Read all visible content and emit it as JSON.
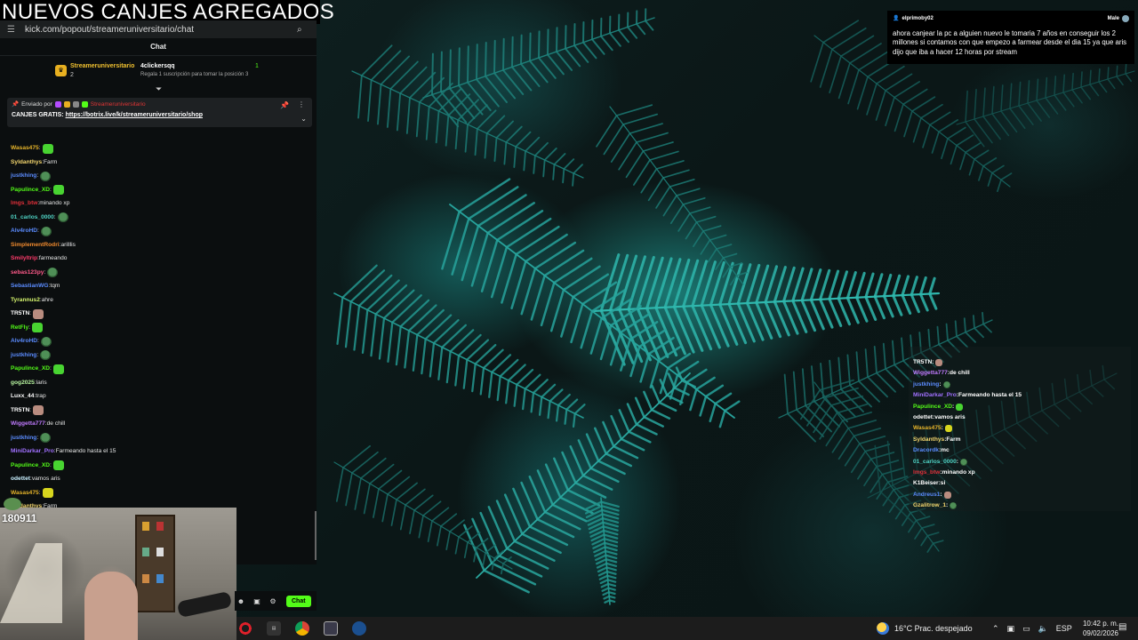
{
  "overlay": {
    "title": "NUEVOS CANJES AGREGADOS"
  },
  "browser": {
    "url": "kick.com/popout/streameruniversitario/chat"
  },
  "chat": {
    "header": "Chat",
    "leaderboard": {
      "first_user": "Streameruniversitario",
      "first_count": "2",
      "badge": "1",
      "second_user": "4clickersqq",
      "second_desc": "Regala 1 suscripción para tomar la posición 3",
      "second_count": "1"
    },
    "pinned": {
      "sent_by": "Enviado por",
      "author": "Streameruniversitario",
      "label": "CANJES GRATIS:",
      "link": "https://botrix.live/k/streameruniversitario/shop"
    },
    "messages": [
      {
        "user": "Wasas475",
        "text": "",
        "color": "#e6b42a",
        "emote": "green"
      },
      {
        "user": "Syldanthys",
        "text": "Farm",
        "color": "#f5d76e",
        "emote": ""
      },
      {
        "user": "justkhing",
        "text": "",
        "color": "#5b8cff",
        "emote": "frog"
      },
      {
        "user": "Papulince_XD",
        "text": "",
        "color": "#53fc18",
        "emote": "green"
      },
      {
        "user": "lmgs_btw",
        "text": "minando xp",
        "color": "#e0303a",
        "emote": ""
      },
      {
        "user": "01_carlos_0000",
        "text": "",
        "color": "#4fd3c4",
        "emote": "frog"
      },
      {
        "user": "Alv4roHD",
        "text": "",
        "color": "#5b8cff",
        "emote": "frog"
      },
      {
        "user": "SimplementRodri",
        "text": "arilllis",
        "color": "#f08a2e",
        "emote": ""
      },
      {
        "user": "Smilyltrip",
        "text": "farmeando",
        "color": "#ff3b6b",
        "emote": ""
      },
      {
        "user": "sebas123py",
        "text": "",
        "color": "#ff5a8a",
        "emote": "frog"
      },
      {
        "user": "SebastianWG",
        "text": "tqm",
        "color": "#5b8cff",
        "emote": ""
      },
      {
        "user": "Tyrannus2",
        "text": "ahre",
        "color": "#d6f56e",
        "emote": ""
      },
      {
        "user": "TR5TN",
        "text": "",
        "color": "#ffffff",
        "emote": "skin"
      },
      {
        "user": "RetFly",
        "text": "",
        "color": "#53fc18",
        "emote": "green"
      },
      {
        "user": "Alv4roHD",
        "text": "",
        "color": "#5b8cff",
        "emote": "frog"
      },
      {
        "user": "justkhing",
        "text": "",
        "color": "#5b8cff",
        "emote": "frog"
      },
      {
        "user": "Papulince_XD",
        "text": "",
        "color": "#53fc18",
        "emote": "green"
      },
      {
        "user": "gog2025",
        "text": "laris",
        "color": "#b8f5a0",
        "emote": ""
      },
      {
        "user": "Luxx_44",
        "text": "trap",
        "color": "#ffffff",
        "emote": ""
      },
      {
        "user": "TR5TN",
        "text": "",
        "color": "#ffffff",
        "emote": "skin"
      },
      {
        "user": "Wiggetta777",
        "text": "de chill",
        "color": "#c07bff",
        "emote": ""
      },
      {
        "user": "justkhing",
        "text": "",
        "color": "#5b8cff",
        "emote": "frog"
      },
      {
        "user": "MiniDarkar_Pro",
        "text": "Farmeando hasta el 15",
        "color": "#a070ff",
        "emote": ""
      },
      {
        "user": "Papulince_XD",
        "text": "",
        "color": "#53fc18",
        "emote": "green"
      },
      {
        "user": "odettet",
        "text": "vamos aris",
        "color": "#c8f0ff",
        "emote": ""
      },
      {
        "user": "Wasas475",
        "text": "",
        "color": "#e6b42a",
        "emote": "yellow"
      },
      {
        "user": "Syldanthys",
        "text": "Farm",
        "color": "#f5d76e",
        "emote": ""
      },
      {
        "user": "Dracordk",
        "text": "mc",
        "color": "#5b8cff",
        "emote": ""
      }
    ],
    "send_label": "Chat"
  },
  "webcam": {
    "sub_count": "180911"
  },
  "tts": {
    "user": "elprimoby02",
    "voice": "Male",
    "message": "ahora canjear la pc a alguien nuevo le tomaria 7 años en conseguir los 2 millones si contamos con que empezo a farmear desde el dia 15 ya que aris dijo que iba a hacer 12 horas por stream"
  },
  "overlay_chat": [
    {
      "user": "TR5TN",
      "text": "",
      "color": "#ffffff",
      "emote": "skin"
    },
    {
      "user": "Wiggetta777",
      "text": "de chill",
      "color": "#c07bff",
      "emote": ""
    },
    {
      "user": "justkhing",
      "text": "",
      "color": "#5b8cff",
      "emote": "frog"
    },
    {
      "user": "MiniDarkar_Pro",
      "text": "Farmeando hasta el 15",
      "color": "#a070ff",
      "emote": ""
    },
    {
      "user": "Papulince_XD",
      "text": "",
      "color": "#53fc18",
      "emote": "green"
    },
    {
      "user": "odettet",
      "text": "vamos aris",
      "color": "#ffffff",
      "emote": ""
    },
    {
      "user": "Wasas475",
      "text": "",
      "color": "#e6b42a",
      "emote": "yellow"
    },
    {
      "user": "Syldanthys",
      "text": "Farm",
      "color": "#f5d76e",
      "emote": ""
    },
    {
      "user": "Dracordk",
      "text": "mc",
      "color": "#5b8cff",
      "emote": ""
    },
    {
      "user": "01_carlos_0000",
      "text": "",
      "color": "#4fd3c4",
      "emote": "frog"
    },
    {
      "user": "lmgs_btw",
      "text": "minando xp",
      "color": "#e0303a",
      "emote": ""
    },
    {
      "user": "K1Beiser",
      "text": "si",
      "color": "#ffffff",
      "emote": ""
    },
    {
      "user": "Andreus1",
      "text": "",
      "color": "#5b8cff",
      "emote": "skin"
    },
    {
      "user": "Gzalitrow_1",
      "text": "",
      "color": "#f5d76e",
      "emote": "frog"
    }
  ],
  "taskbar": {
    "weather": "16°C  Prac. despejado",
    "language": "ESP",
    "time": "10:42 p. m.",
    "date": "09/02/2026"
  }
}
